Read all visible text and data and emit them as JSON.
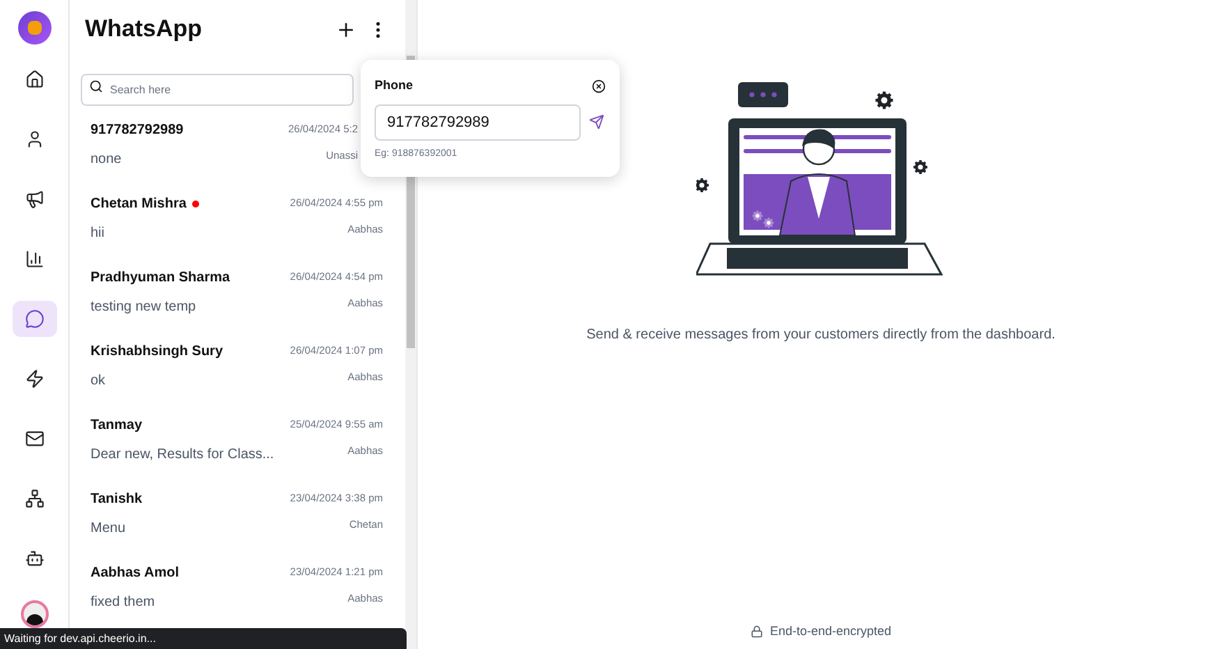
{
  "nav": [
    {
      "selected": false
    },
    {
      "selected": false
    },
    {
      "selected": false
    },
    {
      "selected": false
    },
    {
      "selected": true
    },
    {
      "selected": false
    },
    {
      "selected": false
    },
    {
      "selected": false
    },
    {
      "selected": false
    }
  ],
  "list": {
    "title": "WhatsApp",
    "search_placeholder": "Search here",
    "chats": [
      {
        "name": "917782792989",
        "time": "26/04/2024 5:2",
        "preview": "none",
        "agent": "Unassi",
        "unread": false
      },
      {
        "name": "Chetan Mishra",
        "time": "26/04/2024 4:55 pm",
        "preview": "hii",
        "agent": "Aabhas",
        "unread": true
      },
      {
        "name": "Pradhyuman Sharma",
        "time": "26/04/2024 4:54 pm",
        "preview": "testing new temp",
        "agent": "Aabhas",
        "unread": false
      },
      {
        "name": "Krishabhsingh Sury",
        "time": "26/04/2024 1:07 pm",
        "preview": "ok",
        "agent": "Aabhas",
        "unread": false
      },
      {
        "name": "Tanmay",
        "time": "25/04/2024 9:55 am",
        "preview": "Dear new, Results for Class...",
        "agent": "Aabhas",
        "unread": false
      },
      {
        "name": "Tanishk",
        "time": "23/04/2024 3:38 pm",
        "preview": "Menu",
        "agent": "Chetan",
        "unread": false
      },
      {
        "name": "Aabhas Amol",
        "time": "23/04/2024 1:21 pm",
        "preview": "fixed them",
        "agent": "Aabhas",
        "unread": false
      }
    ]
  },
  "popover": {
    "label": "Phone",
    "value": "917782792989",
    "hint": "Eg: 918876392001"
  },
  "main": {
    "message": "Send & receive messages from your customers directly from the dashboard.",
    "footer": "End-to-end-encrypted"
  },
  "status_bar": "Waiting for dev.api.cheerio.in..."
}
